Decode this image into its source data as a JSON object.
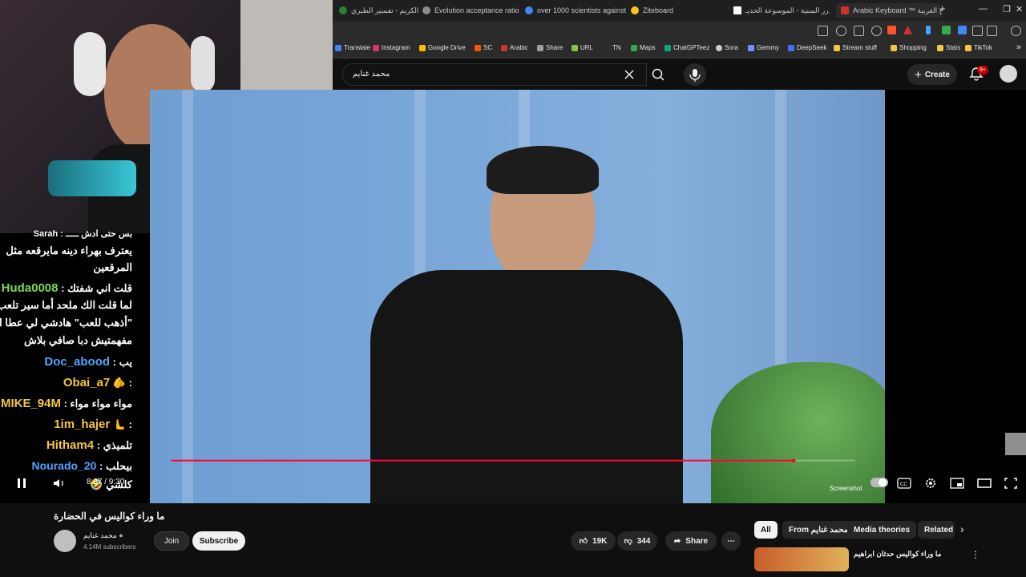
{
  "browser": {
    "tabs": [
      {
        "label": "القرآن الكريم - تفسير الطبري",
        "color": "#2e7d32"
      },
      {
        "label": "Evolution acceptance ratio",
        "color": "#8c8c8c"
      },
      {
        "label": "over 1000 scientists against",
        "color": "#4285f4"
      },
      {
        "label": "Ziteboard",
        "color": "#f5c518"
      },
      {
        "label": "الدرر السنية - الموسوعة الحديـ",
        "color": "#ffffff"
      },
      {
        "label": "Arabic Keyboard ™ لوحة المفاتيح العربية",
        "color": "#d32f2f"
      }
    ],
    "new_tab": "+",
    "window_controls": [
      "—",
      "❐",
      "✕"
    ],
    "bookmarks": [
      {
        "label": "Translate",
        "color": "#4285f4"
      },
      {
        "label": "Instagram",
        "color": "#e1306c"
      },
      {
        "label": "Google Drive",
        "color": "#fbbc04"
      },
      {
        "label": "SC",
        "color": "#ff5500"
      },
      {
        "label": "Arabic",
        "color": "#d32f2f"
      },
      {
        "label": "Share",
        "color": "#9e9e9e"
      },
      {
        "label": "URL",
        "color": "#8bc34a"
      },
      {
        "label": "TN",
        "color": "#9e9e9e"
      },
      {
        "label": "Maps",
        "color": "#34a853"
      },
      {
        "label": "ChatGPTeez",
        "color": "#10a37f"
      },
      {
        "label": "Sora",
        "color": "#cccccc"
      },
      {
        "label": "Gemmy",
        "color": "#7b8cff"
      },
      {
        "label": "DeepSeek",
        "color": "#4d6bfe"
      },
      {
        "label": "Stream stuff",
        "color": "#f4c542"
      },
      {
        "label": "Shopping",
        "color": "#f4c542"
      },
      {
        "label": "Stats",
        "color": "#f4c542"
      },
      {
        "label": "TikTok",
        "color": "#f4c542"
      }
    ],
    "bookmarks_more": "»"
  },
  "youtube": {
    "search_value": "محمد غنايم",
    "create_label": "Create",
    "notif_badge": "9+",
    "player": {
      "time": "8:37 / 9:30",
      "progress": 0.91,
      "screenshot_label": "Screenshot"
    },
    "video_title": "ما وراء كواليس في الحضارة",
    "channel_name": "محمد غنايم",
    "subscribers": "4.14M subscribers",
    "join_label": "Join",
    "subscribe_label": "Subscribe",
    "likes": "19K",
    "dislikes": "344",
    "share_label": "Share",
    "chips": [
      "All",
      "From محمد غنايم",
      "Media theories",
      "Related"
    ],
    "rec_title": "ما وراء كواليس حدثان ابراهيم"
  },
  "chat": [
    {
      "user": "",
      "text": "بس حتى ادش ـــــ : Sarah"
    },
    {
      "user": "",
      "text": "يعترف بهراء دينه مايرقعه مثل"
    },
    {
      "user": "",
      "text": "المرقعين"
    },
    {
      "user": "Huda0008",
      "text": "قلت اني شفتك :"
    },
    {
      "user": "",
      "text": "لما قلت الك ملحد أما سير تلعب تعلي"
    },
    {
      "user": "",
      "text": "\"أذهب للعب\" هادشي لي عطا الله اذا"
    },
    {
      "user": "",
      "text": "مفهمتيش دبا صافي بلاش"
    },
    {
      "user": "Doc_abood",
      "text": "يب :"
    },
    {
      "user": "Obai_a7",
      "text": ": 🫵"
    },
    {
      "user": "MIKE_94M",
      "text": "مواء مواء مواء :"
    },
    {
      "user": "1im_hajer",
      "text": ": 🫷"
    },
    {
      "user": "Hitham4",
      "text": "تلميذي :"
    },
    {
      "user": "Nourado_20",
      "text": "بيحلب :"
    },
    {
      "user": "",
      "text": "كلشي 🤣"
    }
  ],
  "colors": {
    "accent_red": "#ff0033",
    "chat_user": "#7ed957",
    "doc_user": "#4fa3ff",
    "mike_user": "#f5c542"
  }
}
